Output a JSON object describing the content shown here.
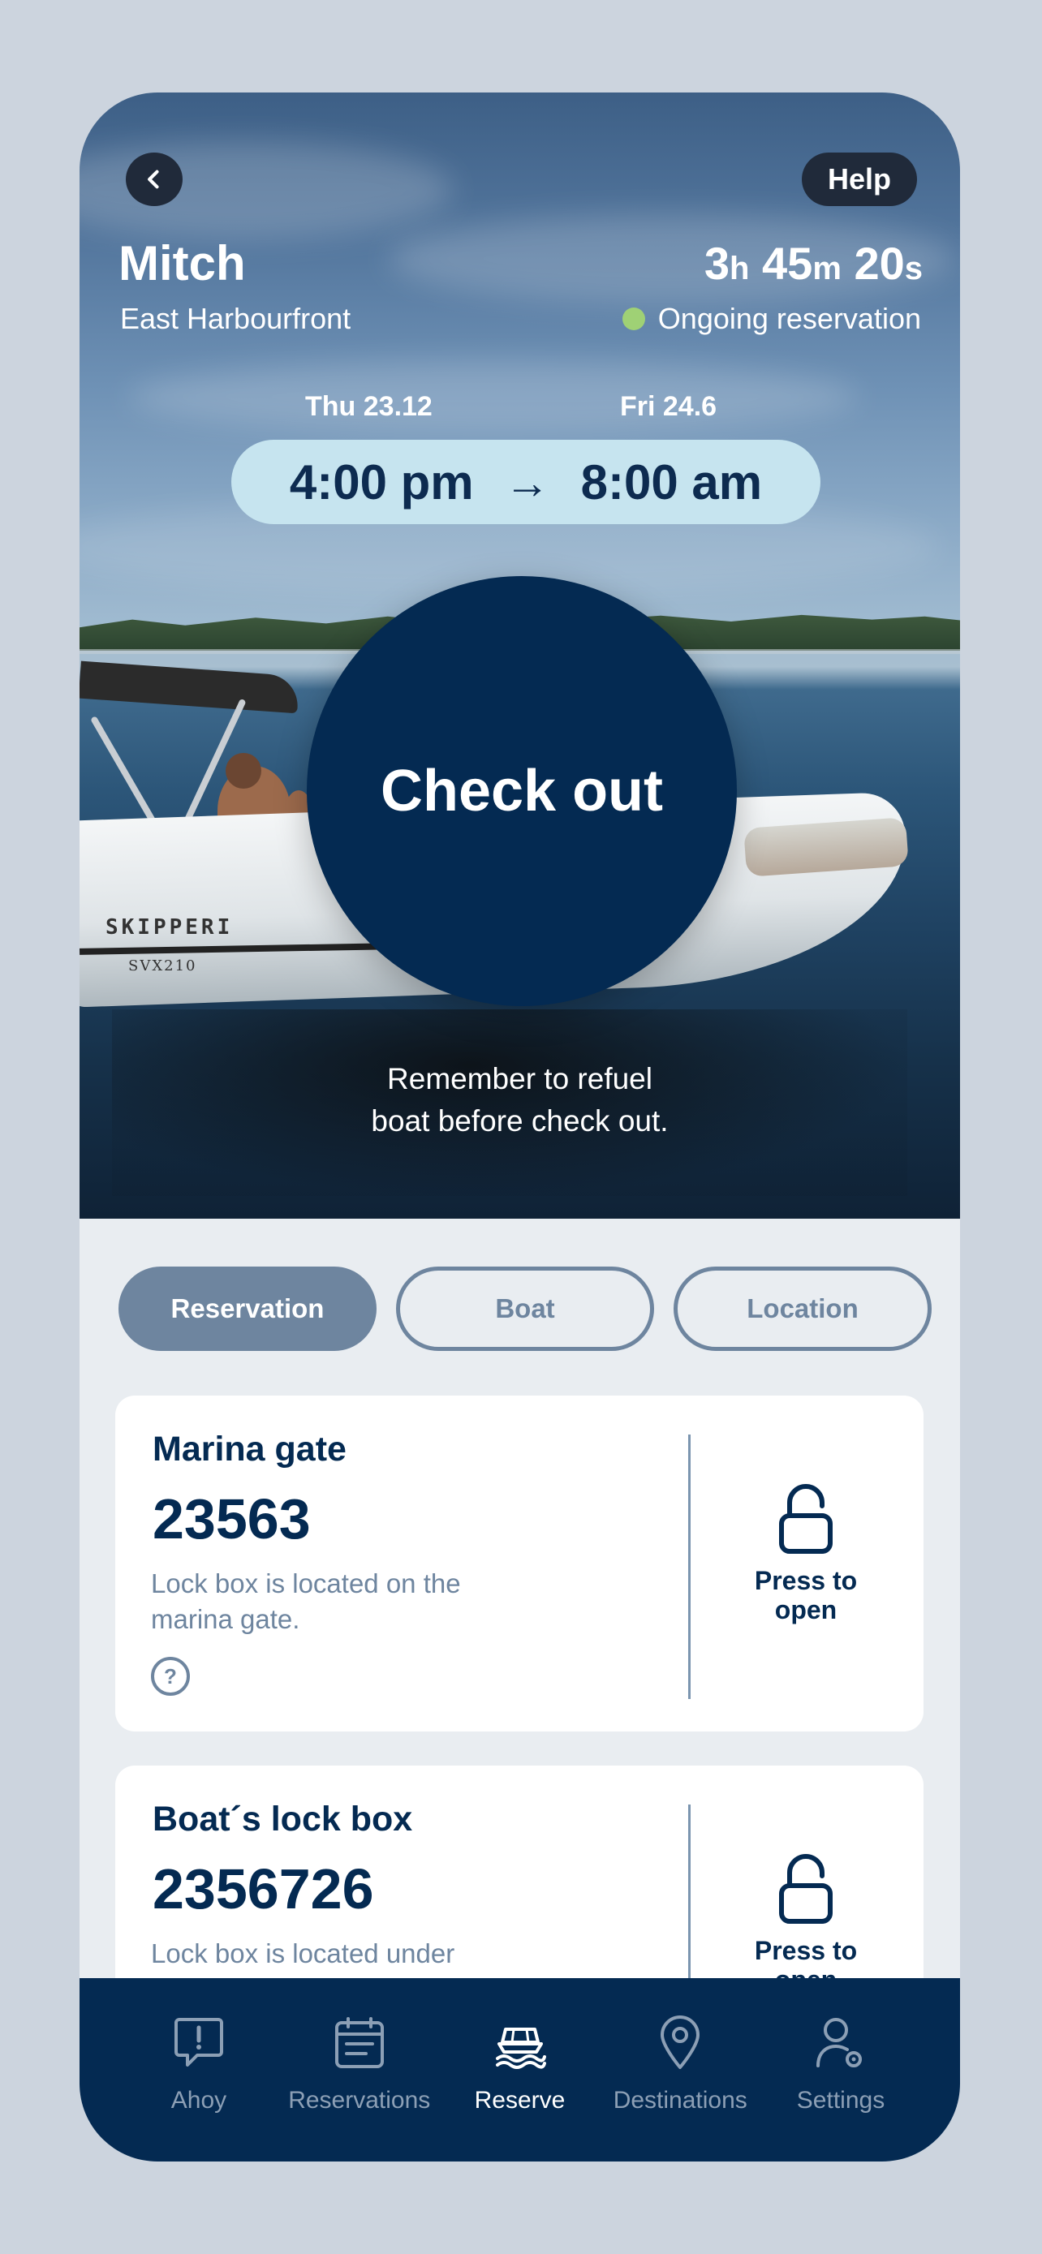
{
  "header": {
    "back_icon": "chevron-left-icon",
    "help_label": "Help",
    "name": "Mitch",
    "location": "East Harbourfront",
    "timer": {
      "hours": "3",
      "h_unit": "h",
      "minutes": "45",
      "m_unit": "m",
      "seconds": "20",
      "s_unit": "s"
    },
    "status": "Ongoing reservation",
    "status_color": "#9fd175"
  },
  "reservation": {
    "from_date": "Thu 23.12",
    "to_date": "Fri 24.6",
    "from_time": "4:00 pm",
    "arrow": "→",
    "to_time": "8:00 am"
  },
  "hero": {
    "boat_brand": "SKIPPERI",
    "boat_model": "SVX210",
    "checkout_label": "Check out",
    "reminder_line1": "Remember to refuel",
    "reminder_line2": "boat before check out."
  },
  "tabs": [
    {
      "label": "Reservation",
      "active": true
    },
    {
      "label": "Boat",
      "active": false
    },
    {
      "label": "Location",
      "active": false
    }
  ],
  "cards": [
    {
      "title": "Marina gate",
      "code": "23563",
      "desc_line1": "Lock box is located on the",
      "desc_line2": "marina gate.",
      "help_symbol": "?",
      "action_line1": "Press to",
      "action_line2": "open",
      "icon": "unlock-icon"
    },
    {
      "title": "Boat´s lock box",
      "code": "2356726",
      "desc_line1": "Lock box is located under",
      "desc_line2": "",
      "action_line1": "Press to",
      "action_line2": "open",
      "icon": "unlock-icon"
    }
  ],
  "nav": [
    {
      "label": "Ahoy",
      "icon": "alert-bubble-icon",
      "active": false
    },
    {
      "label": "Reservations",
      "icon": "calendar-icon",
      "active": false
    },
    {
      "label": "Reserve",
      "icon": "boat-icon",
      "active": true
    },
    {
      "label": "Destinations",
      "icon": "map-pin-icon",
      "active": false
    },
    {
      "label": "Settings",
      "icon": "user-settings-icon",
      "active": false
    }
  ],
  "colors": {
    "navy": "#042a52",
    "slate": "#6e859f",
    "pill": "#c6e4ef",
    "background": "#ccd4de"
  }
}
